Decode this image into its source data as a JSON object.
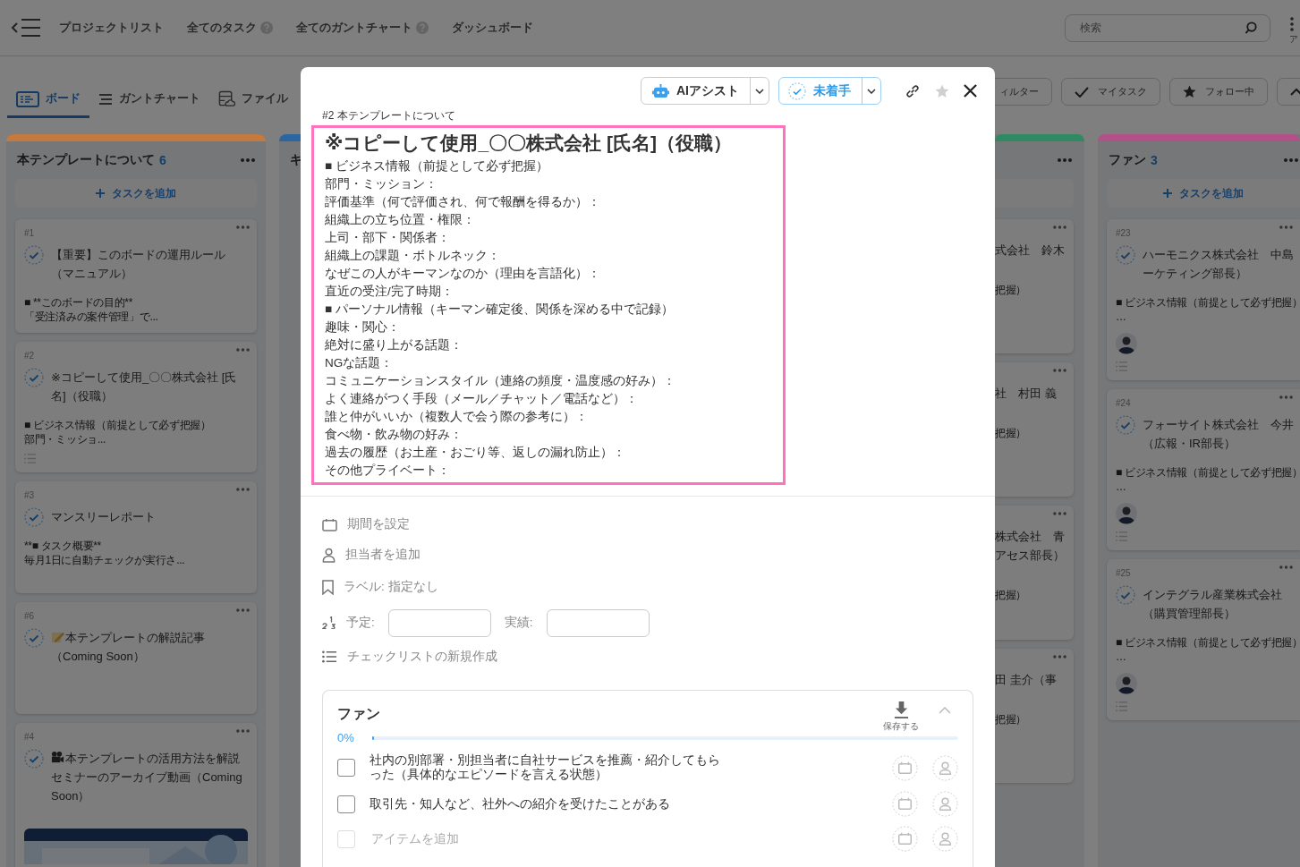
{
  "top_nav": {
    "links": [
      {
        "label": "プロジェクトリスト",
        "help": false
      },
      {
        "label": "全てのタスク",
        "help": true
      },
      {
        "label": "全てのガントチャート",
        "help": true
      },
      {
        "label": "ダッシュボード",
        "help": false
      }
    ],
    "search": {
      "placeholder": "検索"
    },
    "apps_label": "ア"
  },
  "view_tabs": [
    {
      "label": "ボード",
      "selected": true
    },
    {
      "label": "ガントチャート",
      "selected": false
    },
    {
      "label": "ファイル",
      "selected": false
    }
  ],
  "toolbar": [
    {
      "kind": "button",
      "label": "ィルター"
    },
    {
      "kind": "button",
      "label": "マイタスク"
    },
    {
      "kind": "button",
      "label": "フォロー中"
    },
    {
      "kind": "collapse"
    }
  ],
  "columns": [
    {
      "kind": "full",
      "color": "#c47a3e",
      "title": "本テンプレートについて",
      "count": "6",
      "add_label": "タスクを追加",
      "cards": [
        {
          "number": "#1",
          "title": "【重要】このボードの運用ルール（マニュアル）",
          "preview": [
            "■ **このボードの目的**",
            "「受注済みの案件管理」で..."
          ],
          "checklist": false,
          "avatar": false
        },
        {
          "number": "#2",
          "title": "※コピーして使用_〇〇株式会社 [氏名]（役職）",
          "preview": [
            "■ ビジネス情報（前提として必ず把握）",
            "部門・ミッショ..."
          ],
          "checklist": true,
          "avatar": false
        },
        {
          "number": "#3",
          "title": "マンスリーレポート",
          "preview": [
            "**■ タスク概要**",
            "毎月1日に自動チェックが実行さ..."
          ],
          "checklist": false,
          "avatar": false
        },
        {
          "number": "#6",
          "title": "本テンプレートの解説記事（Coming Soon）",
          "checklist": false,
          "avatar": false
        },
        {
          "number": "#4",
          "title": "本テンプレートの活用方法を解説セミナーのアーカイブ動画（Coming Soon）",
          "checklist": false,
          "avatar": false
        }
      ]
    },
    {
      "kind": "stub",
      "color": "#2b66a3",
      "title": "キ"
    },
    {
      "kind": "clipped",
      "color": "#2f8a63",
      "cards": [
        {
          "title_lines": [
            "式会社　鈴木"
          ],
          "preview": [
            "把握）"
          ]
        },
        {
          "title_lines": [
            "社　村田 義"
          ],
          "preview": [
            "把握）"
          ]
        },
        {
          "title_lines": [
            "株式会社　青",
            "アセス部長）"
          ],
          "preview": [
            "把握）"
          ]
        },
        {
          "title_lines": [
            "田 圭介（事"
          ],
          "preview": [
            "把握）"
          ]
        }
      ]
    },
    {
      "kind": "full",
      "color": "#b2508a",
      "title": "ファン",
      "count": "3",
      "add_label": "タスクを追加",
      "cards": [
        {
          "number": "#23",
          "title_lines": [
            "ハーモニクス株式会社　中島",
            "ーケティング部長）"
          ],
          "preview": [
            "■ ビジネス情報（前提として必ず把握）",
            "…"
          ],
          "checklist": true,
          "avatar": true
        },
        {
          "number": "#24",
          "title_lines": [
            "フォーサイト株式会社　今井",
            "（広報・IR部長）"
          ],
          "preview": [
            "■ ビジネス情報（前提として必ず把握）",
            "…"
          ],
          "checklist": true,
          "avatar": true
        },
        {
          "number": "#25",
          "title_lines": [
            "インテグラル産業株式会社",
            "（購買管理部長）"
          ],
          "preview": [
            "■ ビジネス情報（前提として必ず把握）",
            "…"
          ],
          "checklist": true,
          "avatar": true
        }
      ]
    }
  ],
  "modal": {
    "ai_button": "AIアシスト",
    "status": {
      "label": "未着手",
      "done": false
    },
    "starred": false,
    "breadcrumb": "#2 本テンプレートについて",
    "description": {
      "highlighted": true,
      "title": "※コピーして使用_〇〇株式会社 [氏名]（役職）",
      "lines": [
        "■ ビジネス情報（前提として必ず把握）",
        "部門・ミッション：",
        "評価基準（何で評価され、何で報酬を得るか）：",
        "組織上の立ち位置・権限：",
        "上司・部下・関係者：",
        "組織上の課題・ボトルネック：",
        "なぜこの人がキーマンなのか（理由を言語化）：",
        "直近の受注/完了時期：",
        "■ パーソナル情報（キーマン確定後、関係を深める中で記録）",
        "趣味・関心：",
        "絶対に盛り上がる話題：",
        "NGな話題：",
        "コミュニケーションスタイル（連絡の頻度・温度感の好み）：",
        "よく連絡がつく手段（メール／チャット／電話など）：",
        "誰と仲がいいか（複数人で会う際の参考に）：",
        "食べ物・飲み物の好み：",
        "過去の履歴（お土産・おごり等、返しの漏れ防止）：",
        "その他プライベート："
      ]
    },
    "properties": [
      {
        "kind": "date",
        "label": "期間を設定"
      },
      {
        "kind": "assignee",
        "label": "担当者を追加"
      },
      {
        "kind": "label",
        "label": "ラベル: 指定なし"
      },
      {
        "kind": "estimate",
        "label": "予定:",
        "actual_label": "実績:"
      },
      {
        "kind": "checklist",
        "label": "チェックリストの新規作成"
      }
    ],
    "checklist": {
      "title": "ファン",
      "save_label": "保存する",
      "expanded": true,
      "progress": "0%",
      "level": 0,
      "items": [
        {
          "text": "社内の別部署・別担当者に自社サービスを推薦・紹介してもらった（具体的なエピソードを言える状態）",
          "checked": false
        },
        {
          "text": "取引先・知人など、社外への紹介を受けたことがある",
          "checked": false
        }
      ],
      "add_item": {
        "placeholder": "アイテムを追加",
        "checked": false
      }
    }
  }
}
